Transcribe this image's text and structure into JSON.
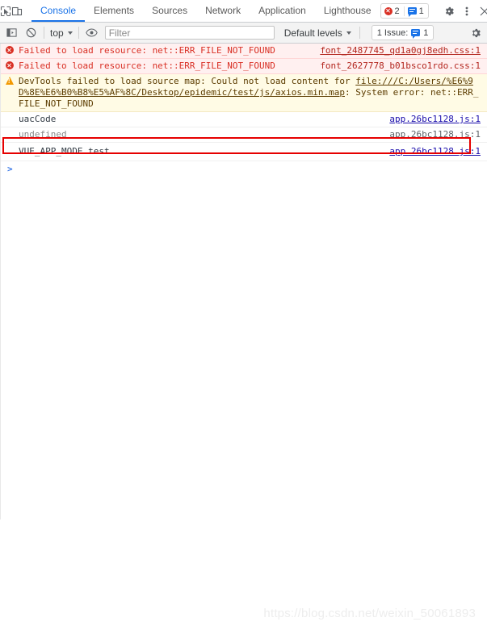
{
  "tabbar": {
    "inspect_icon": "inspect-cursor-icon",
    "device_icon": "device-toolbar-icon",
    "tabs": [
      {
        "label": "Console",
        "active": true
      },
      {
        "label": "Elements",
        "active": false
      },
      {
        "label": "Sources",
        "active": false
      },
      {
        "label": "Network",
        "active": false
      },
      {
        "label": "Application",
        "active": false
      },
      {
        "label": "Lighthouse",
        "active": false
      }
    ],
    "error_count": "2",
    "message_count": "1",
    "settings_label": "gear-icon",
    "more_label": "kebab-menu-icon",
    "close_label": "close-icon"
  },
  "toolbar": {
    "sidebar_toggle": "console-sidebar-icon",
    "clear_label": "clear-console-icon",
    "context": "top",
    "eye_label": "live-expression-icon",
    "filter_value": "",
    "filter_placeholder": "Filter",
    "levels": "Default levels",
    "issues_text": "1 Issue:",
    "issues_count": "1",
    "settings_label": "console-settings-icon"
  },
  "console": {
    "rows": [
      {
        "type": "error",
        "text": "Failed to load resource: net::ERR_FILE_NOT_FOUND",
        "source": "font_2487745_qd1a0gj8edh.css:1"
      },
      {
        "type": "error",
        "text": "Failed to load resource: net::ERR_FILE_NOT_FOUND",
        "source": "font_2627778_b01bsco1rdo.css:1"
      },
      {
        "type": "warn",
        "text_before": "DevTools failed to load source map: Could not load content for ",
        "link": "file:///C:/Users/%E6%9D%8E%E6%B0%B8%E5%AF%8C/Desktop/epidemic/test/js/axios.min.map",
        "text_after": ": System error: net::ERR_FILE_NOT_FOUND",
        "source": ""
      },
      {
        "type": "info",
        "text": "uacCode",
        "source": "app.26bc1128.js:1",
        "link_style": true
      },
      {
        "type": "info",
        "text": "undefined",
        "source": "app.26bc1128.js:1",
        "link_style": false
      },
      {
        "type": "info",
        "text": "VUE_APP_MODE test",
        "source": "app.26bc1128.js:1",
        "link_style": true,
        "highlighted": true
      }
    ],
    "prompt": ">"
  },
  "watermark": "https://blog.csdn.net/weixin_50061893",
  "colors": {
    "accent": "#1a73e8",
    "error": "#d93025",
    "warning": "#f29900",
    "highlight_box": "#e60000",
    "error_bg": "#fff0f0",
    "warning_bg": "#fffbe5",
    "link": "#1a0dab"
  }
}
